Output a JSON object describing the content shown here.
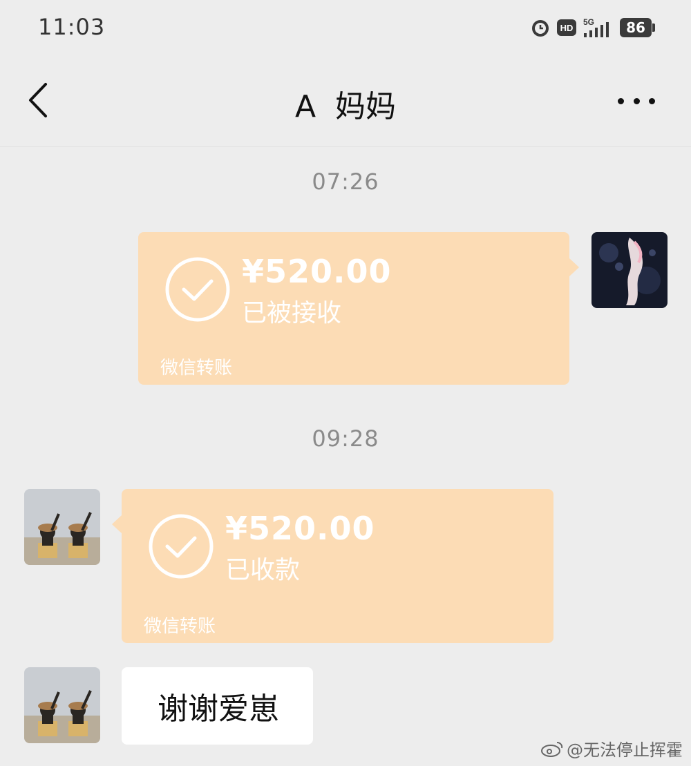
{
  "status_bar": {
    "time": "11:03",
    "network": "5G",
    "hd_label": "HD",
    "battery": "86"
  },
  "header": {
    "title": "A  妈妈"
  },
  "messages": [
    {
      "timestamp": "07:26",
      "type": "transfer",
      "side": "right",
      "amount": "¥520.00",
      "status": "已被接收",
      "footer": "微信转账"
    },
    {
      "timestamp": "09:28",
      "type": "transfer",
      "side": "left",
      "amount": "¥520.00",
      "status": "已收款",
      "footer": "微信转账"
    },
    {
      "type": "text",
      "side": "left",
      "text": "谢谢爱崽"
    }
  ],
  "watermark": "@无法停止挥霍",
  "colors": {
    "background": "#ededed",
    "transfer_card": "#fcdcb5",
    "text_bubble": "#ffffff"
  }
}
